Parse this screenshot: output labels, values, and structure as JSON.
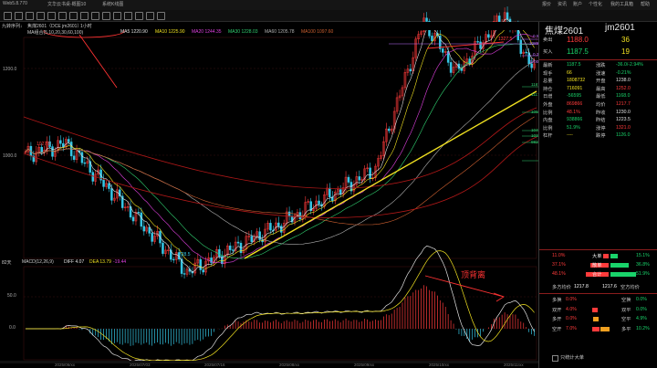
{
  "window": {
    "title": "Web5.8.770",
    "tabs": [
      "文华云书桌-概图10",
      "系统K线图"
    ],
    "right_menu": [
      "报价",
      "资讯",
      "账户",
      "个性化",
      "我的工具箱",
      "帮助"
    ]
  },
  "toolbar": {
    "left_label": "九转序列↓"
  },
  "instrument_bar": {
    "title": "焦煤2601（DCE jm2601）",
    "period": "1小时"
  },
  "indicators": {
    "ma_title": "MA组合(5,10,20,30,60,100)",
    "ma5": "MA5 1220.90",
    "ma10": "MA10 1225.90",
    "ma20": "MA20 1244.35",
    "ma30": "MA30 1228.03",
    "ma60": "MA60 1205.78",
    "ma100": "MA100 1097.60",
    "macd_title": "MACD(12,26,9)",
    "diff": "DIFF 4.07",
    "dea": "DEA 13.79",
    "macd": "-19.44",
    "extra": "82天"
  },
  "price_axis": {
    "labels": [
      "1200.0",
      "1000.0"
    ],
    "macd_labels": [
      "50.0",
      "0.0"
    ]
  },
  "chart_marks": {
    "peak": "1327.5",
    "peak_left": "1027.0",
    "low": "728.5",
    "fib_levels": [
      "0.500",
      "1289.5",
      "0.382",
      "1200.9",
      "1167.0",
      "1117.0",
      "1065.5",
      "1049.5",
      "1033.0",
      "982.0"
    ]
  },
  "annotations": {
    "divergence": "顶背离"
  },
  "x_labels": [
    "2025/06/xx",
    "2025/07/03",
    "2025/07/16",
    "2025/08/xx",
    "2025/09/xx",
    "2025/10/xx",
    "2025/11/xx"
  ],
  "quote": {
    "symbol": "焦煤2601",
    "code": "jm2601",
    "sell_label": "卖出",
    "sell_price": "1188.0",
    "sell_vol": "36",
    "buy_label": "买入",
    "buy_price": "1187.5",
    "buy_vol": "19",
    "rows": [
      {
        "l1": "最新",
        "v1": "1187.5",
        "l2": "涨跌",
        "v2": "-36.0/-2.94%"
      },
      {
        "l1": "现手",
        "v1": "66",
        "l2": "涨速",
        "v2": "-0.21%"
      },
      {
        "l1": "总量",
        "v1": "1808732",
        "l2": "开盘",
        "v2": "1238.0"
      },
      {
        "l1": "持仓",
        "v1": "716091",
        "l2": "最高",
        "v2": "1252.0"
      },
      {
        "l1": "日增",
        "v1": "-56595",
        "l2": "最低",
        "v2": "1168.0"
      },
      {
        "l1": "外盘",
        "v1": "869866",
        "l2": "均价",
        "v2": "1217.7"
      },
      {
        "l1": "比例",
        "v1": "48.1%",
        "l2": "昨收",
        "v2": "1230.0"
      },
      {
        "l1": "内盘",
        "v1": "938866",
        "l2": "昨结",
        "v2": "1223.5"
      },
      {
        "l1": "比例",
        "v1": "51.9%",
        "l2": "涨停",
        "v2": "1321.0"
      },
      {
        "l1": "杠杆",
        "v1": "----",
        "l2": "跌停",
        "v2": "1126.0"
      }
    ],
    "flow": [
      {
        "left": "11.0%",
        "label": "大单",
        "right": "15.1%"
      },
      {
        "left": "37.1%",
        "label": "散单",
        "right": "36.8%"
      },
      {
        "left": "48.1%",
        "label": "合计",
        "right": "51.9%"
      }
    ],
    "avg_row": {
      "l": "多方均价",
      "v1": "1217.8",
      "v2": "1217.6",
      "r": "空方均价"
    },
    "pos_rows": [
      {
        "l": "多换",
        "v1": "0.0%",
        "r": "空换",
        "v2": "0.0%"
      },
      {
        "l": "双开",
        "v1": "4.0%",
        "r": "双平",
        "v2": "0.0%"
      },
      {
        "l": "多开",
        "v1": "0.0%",
        "r": "空平",
        "v2": "4.9%"
      },
      {
        "l": "空开",
        "v1": "7.0%",
        "r": "多平",
        "v2": "10.2%"
      }
    ],
    "stat_label": "只统计大单"
  },
  "colors": {
    "up": "#ff3b3b",
    "down": "#19d36a",
    "trend": "#f0e020",
    "candle_down": "#35c7e6"
  }
}
